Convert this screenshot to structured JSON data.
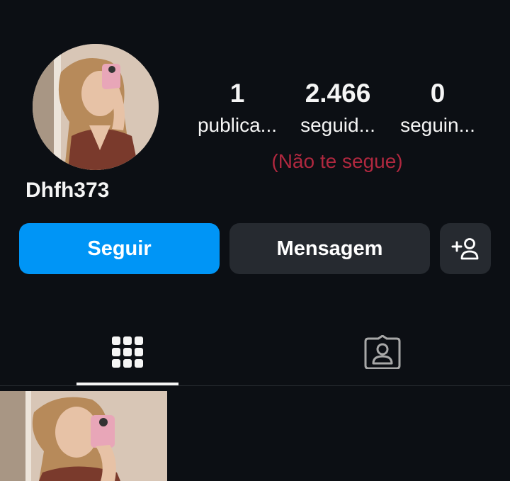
{
  "profile": {
    "username": "Dhfh373",
    "not_following_note": "(Não te segue)"
  },
  "stats": {
    "posts": {
      "count": "1",
      "label": "publica..."
    },
    "followers": {
      "count": "2.466",
      "label": "seguid..."
    },
    "following": {
      "count": "0",
      "label": "seguin..."
    }
  },
  "actions": {
    "follow_label": "Seguir",
    "message_label": "Mensagem",
    "add_user_icon": "person-plus-icon"
  },
  "tabs": [
    {
      "name": "grid",
      "icon": "grid-icon",
      "active": true
    },
    {
      "name": "tagged",
      "icon": "tagged-person-icon",
      "active": false
    }
  ],
  "colors": {
    "background": "#0c0f14",
    "follow_button": "#0095f6",
    "secondary_button": "#262a30",
    "not_following_text": "#b0283f",
    "text": "#f5f5f5"
  }
}
